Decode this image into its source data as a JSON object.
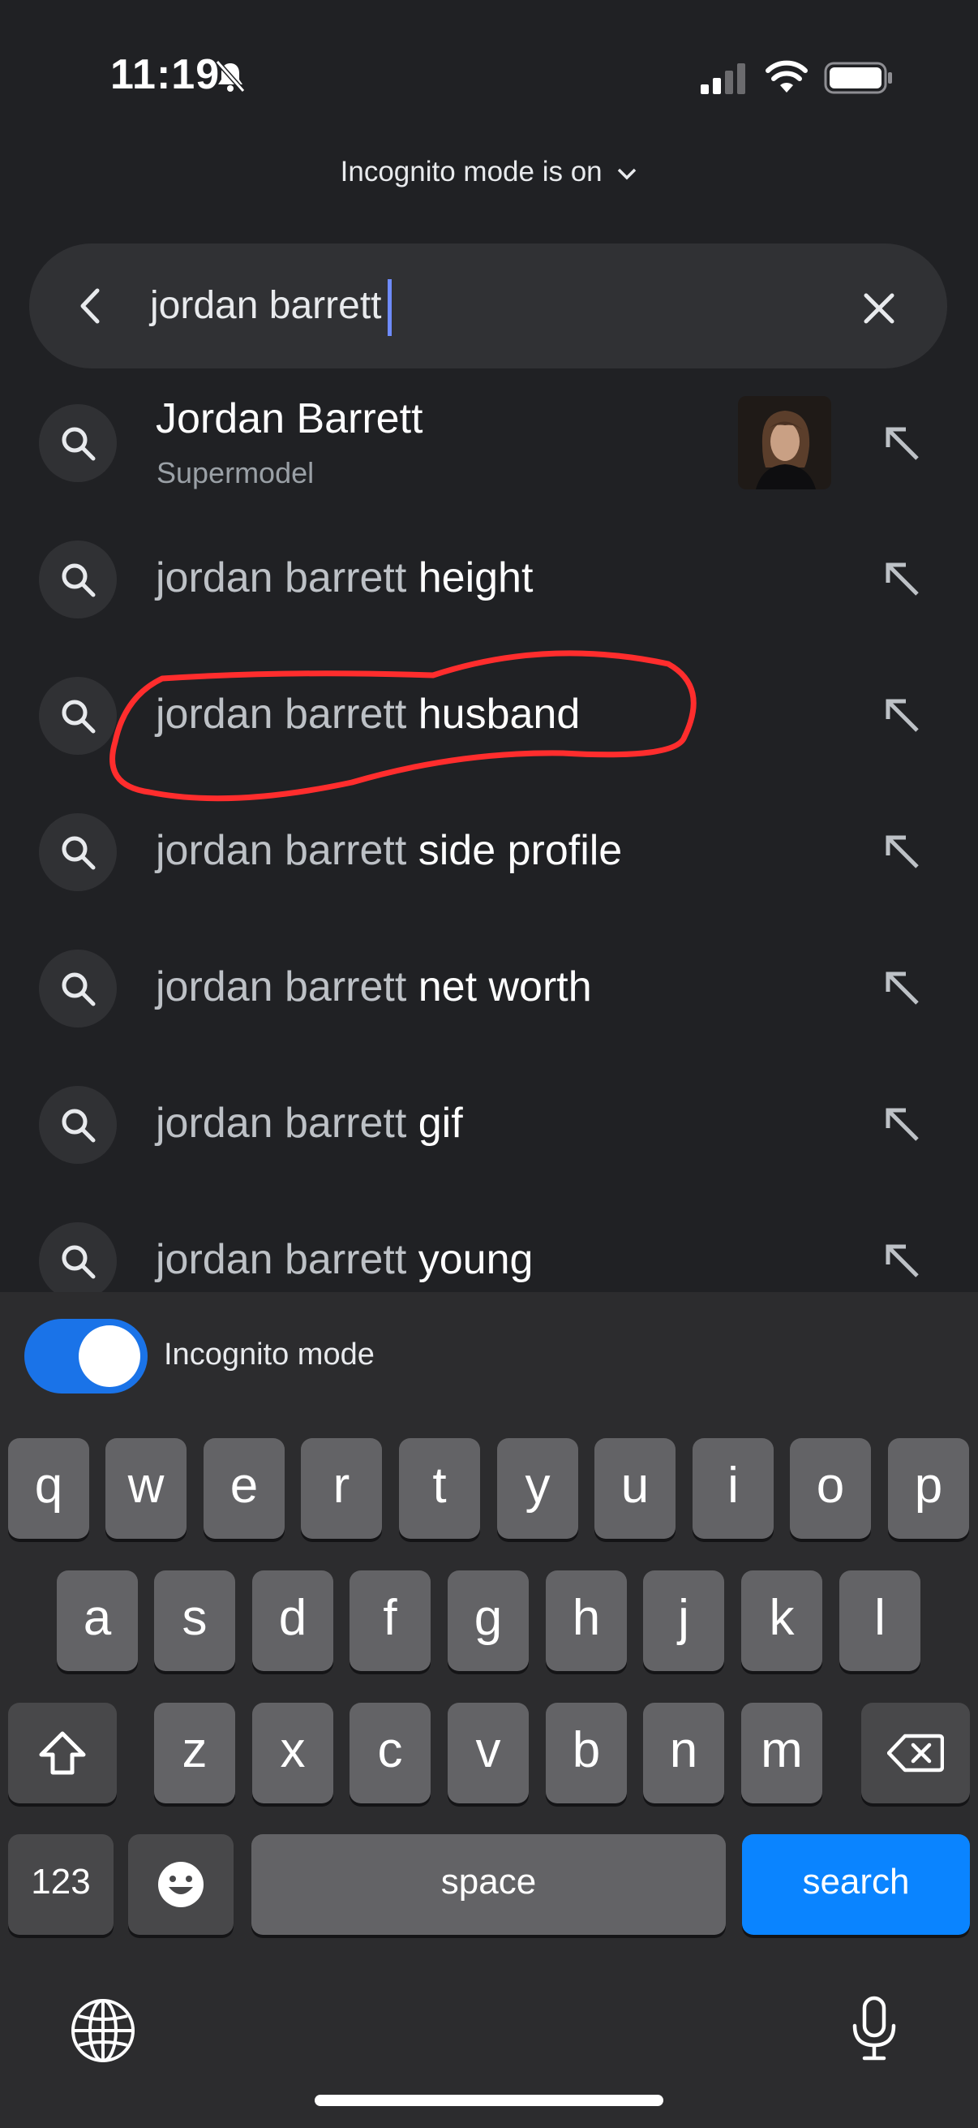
{
  "status_bar": {
    "time": "11:19"
  },
  "banner": {
    "text": "Incognito mode is on"
  },
  "search": {
    "query": "jordan barrett"
  },
  "suggestions": [
    {
      "title": "Jordan Barrett",
      "subtitle": "Supermodel"
    },
    {
      "prefix": "jordan barrett",
      "suffix": " height"
    },
    {
      "prefix": "jordan barrett",
      "suffix": " husband"
    },
    {
      "prefix": "jordan barrett",
      "suffix": " side profile"
    },
    {
      "prefix": "jordan barrett",
      "suffix": " net worth"
    },
    {
      "prefix": "jordan barrett",
      "suffix": " gif"
    },
    {
      "prefix": "jordan barrett",
      "suffix": " young"
    }
  ],
  "incognito_toggle": {
    "label": "Incognito mode",
    "on": true
  },
  "keyboard": {
    "row1": [
      "q",
      "w",
      "e",
      "r",
      "t",
      "y",
      "u",
      "i",
      "o",
      "p"
    ],
    "row2": [
      "a",
      "s",
      "d",
      "f",
      "g",
      "h",
      "j",
      "k",
      "l"
    ],
    "row3": [
      "z",
      "x",
      "c",
      "v",
      "b",
      "n",
      "m"
    ],
    "numbers_label": "123",
    "space_label": "space",
    "action_label": "search"
  },
  "colors": {
    "accent": "#1a73e8",
    "highlight": "#ff2d2d",
    "search_key": "#0a84ff"
  },
  "icons": [
    "bell-slash-icon",
    "signal-icon",
    "wifi-icon",
    "battery-icon",
    "chevron-down-icon",
    "back-arrow-icon",
    "close-icon",
    "search-icon",
    "arrow-up-left-icon",
    "shift-icon",
    "backspace-icon",
    "emoji-icon",
    "globe-icon",
    "microphone-icon"
  ]
}
